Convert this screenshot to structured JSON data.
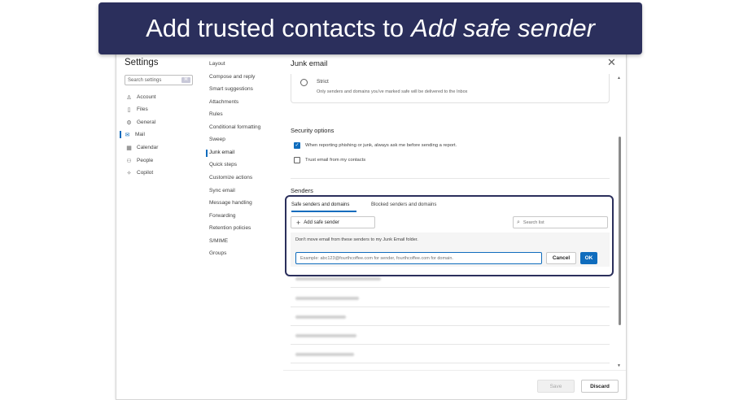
{
  "banner": {
    "prefix": "Add trusted contacts to",
    "emphasis": "Add safe sender"
  },
  "settings": {
    "title": "Settings",
    "search_placeholder": "Search settings",
    "nav": [
      {
        "label": "Account",
        "icon": "person-icon"
      },
      {
        "label": "Files",
        "icon": "file-icon"
      },
      {
        "label": "General",
        "icon": "gear-icon"
      },
      {
        "label": "Mail",
        "icon": "mail-icon",
        "active": true
      },
      {
        "label": "Calendar",
        "icon": "calendar-icon"
      },
      {
        "label": "People",
        "icon": "people-icon"
      },
      {
        "label": "Copilot",
        "icon": "copilot-icon"
      }
    ],
    "subnav": [
      "Layout",
      "Compose and reply",
      "Smart suggestions",
      "Attachments",
      "Rules",
      "Conditional formatting",
      "Sweep",
      "Junk email",
      "Quick steps",
      "Customize actions",
      "Sync email",
      "Message handling",
      "Forwarding",
      "Retention policies",
      "S/MIME",
      "Groups"
    ],
    "active_subnav": "Junk email"
  },
  "panel": {
    "title": "Junk email",
    "strict_label": "Strict",
    "strict_desc": "Only senders and domains you've marked safe will be delivered to the Inbox",
    "security_title": "Security options",
    "security_options": [
      {
        "label": "When reporting phishing or junk, always ask me before sending a report.",
        "checked": true
      },
      {
        "label": "Trust email from my contacts",
        "checked": false
      }
    ],
    "senders_title": "Senders",
    "tabs": [
      "Safe senders and domains",
      "Blocked senders and domains"
    ],
    "add_button": "Add safe sender",
    "search_list_placeholder": "Search list",
    "note": "Don't move email from these senders to my Junk Email folder.",
    "entry_placeholder": "Example: abc123@fourthcoffee.com for sender, fourthcoffee.com for domain.",
    "cancel": "Cancel",
    "ok": "OK",
    "save": "Save",
    "discard": "Discard"
  },
  "colors": {
    "banner_bg": "#2b2f5c",
    "accent": "#0f6cbd"
  }
}
